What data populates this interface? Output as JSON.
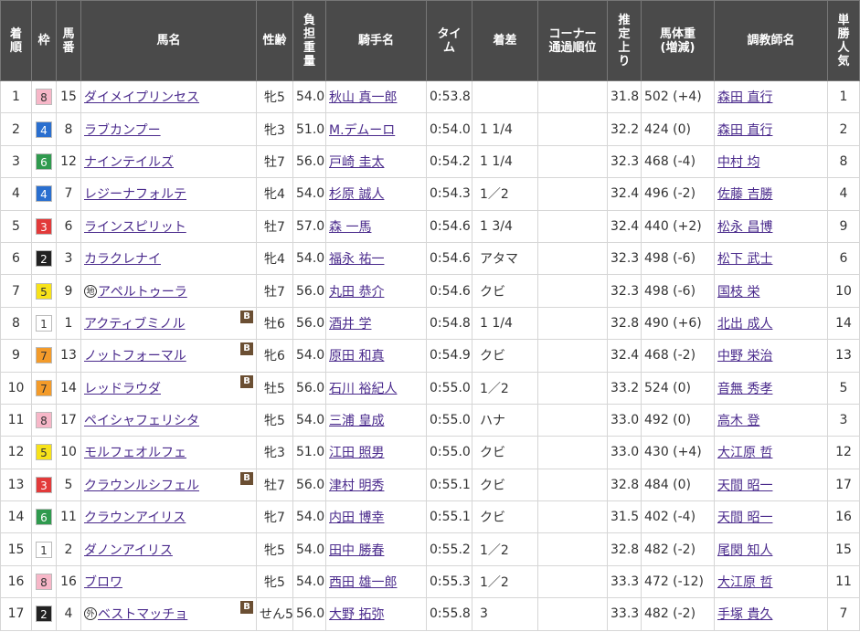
{
  "headers": {
    "rank": "着\n順",
    "waku": "枠",
    "umaban": "馬\n番",
    "horse": "馬名",
    "sexage": "性齢",
    "weight": "負\n担\n重\n量",
    "jockey": "騎手名",
    "time": "タイ\nム",
    "margin": "着差",
    "corner": "コーナー\n通過順位",
    "agari": "推\n定\n上\nり",
    "bodyweight": "馬体重\n(増減)",
    "trainer": "調教師名",
    "pop": "単\n勝\n人\n気"
  },
  "colors": {
    "header_bg": "#4a4a4a",
    "link": "#4a2a8c",
    "waku": {
      "1": {
        "bg": "#ffffff",
        "fg": "#333333"
      },
      "2": {
        "bg": "#222222",
        "fg": "#ffffff"
      },
      "3": {
        "bg": "#e23a3a",
        "fg": "#ffffff"
      },
      "4": {
        "bg": "#2a6fcf",
        "fg": "#ffffff"
      },
      "5": {
        "bg": "#f7e21a",
        "fg": "#333333"
      },
      "6": {
        "bg": "#2f9a4e",
        "fg": "#ffffff"
      },
      "7": {
        "bg": "#f39b2a",
        "fg": "#333333"
      },
      "8": {
        "bg": "#f7b7c8",
        "fg": "#333333"
      }
    }
  },
  "rows": [
    {
      "rank": "1",
      "waku": "8",
      "umaban": "15",
      "mark": "",
      "horse": "ダイメイプリンセス",
      "blinker": "",
      "sexage": "牝5",
      "weight": "54.0",
      "jockey": "秋山 真一郎",
      "time": "0:53.8",
      "margin": "",
      "corner": "",
      "agari": "31.8",
      "bodyweight": "502 (+4)",
      "trainer": "森田 直行",
      "pop": "1"
    },
    {
      "rank": "2",
      "waku": "4",
      "umaban": "8",
      "mark": "",
      "horse": "ラブカンプー",
      "blinker": "",
      "sexage": "牝3",
      "weight": "51.0",
      "jockey": "M.デムーロ",
      "time": "0:54.0",
      "margin": "1 1/4",
      "corner": "",
      "agari": "32.2",
      "bodyweight": "424 (0)",
      "trainer": "森田 直行",
      "pop": "2"
    },
    {
      "rank": "3",
      "waku": "6",
      "umaban": "12",
      "mark": "",
      "horse": "ナインテイルズ",
      "blinker": "",
      "sexage": "牡7",
      "weight": "56.0",
      "jockey": "戸崎 圭太",
      "time": "0:54.2",
      "margin": "1 1/4",
      "corner": "",
      "agari": "32.3",
      "bodyweight": "468 (-4)",
      "trainer": "中村 均",
      "pop": "8"
    },
    {
      "rank": "4",
      "waku": "4",
      "umaban": "7",
      "mark": "",
      "horse": "レジーナフォルテ",
      "blinker": "",
      "sexage": "牝4",
      "weight": "54.0",
      "jockey": "杉原 誠人",
      "time": "0:54.3",
      "margin": "1／2",
      "corner": "",
      "agari": "32.4",
      "bodyweight": "496 (-2)",
      "trainer": "佐藤 吉勝",
      "pop": "4"
    },
    {
      "rank": "5",
      "waku": "3",
      "umaban": "6",
      "mark": "",
      "horse": "ラインスピリット",
      "blinker": "",
      "sexage": "牡7",
      "weight": "57.0",
      "jockey": "森 一馬",
      "time": "0:54.6",
      "margin": "1 3/4",
      "corner": "",
      "agari": "32.4",
      "bodyweight": "440 (+2)",
      "trainer": "松永 昌博",
      "pop": "9"
    },
    {
      "rank": "6",
      "waku": "2",
      "umaban": "3",
      "mark": "",
      "horse": "カラクレナイ",
      "blinker": "",
      "sexage": "牝4",
      "weight": "54.0",
      "jockey": "福永 祐一",
      "time": "0:54.6",
      "margin": "アタマ",
      "corner": "",
      "agari": "32.3",
      "bodyweight": "498 (-6)",
      "trainer": "松下 武士",
      "pop": "6"
    },
    {
      "rank": "7",
      "waku": "5",
      "umaban": "9",
      "mark": "地",
      "horse": "アペルトゥーラ",
      "blinker": "",
      "sexage": "牡7",
      "weight": "56.0",
      "jockey": "丸田 恭介",
      "time": "0:54.6",
      "margin": "クビ",
      "corner": "",
      "agari": "32.3",
      "bodyweight": "498 (-6)",
      "trainer": "国枝 栄",
      "pop": "10"
    },
    {
      "rank": "8",
      "waku": "1",
      "umaban": "1",
      "mark": "",
      "horse": "アクティブミノル",
      "blinker": "B",
      "sexage": "牡6",
      "weight": "56.0",
      "jockey": "酒井 学",
      "time": "0:54.8",
      "margin": "1 1/4",
      "corner": "",
      "agari": "32.8",
      "bodyweight": "490 (+6)",
      "trainer": "北出 成人",
      "pop": "14"
    },
    {
      "rank": "9",
      "waku": "7",
      "umaban": "13",
      "mark": "",
      "horse": "ノットフォーマル",
      "blinker": "B",
      "sexage": "牝6",
      "weight": "54.0",
      "jockey": "原田 和真",
      "time": "0:54.9",
      "margin": "クビ",
      "corner": "",
      "agari": "32.4",
      "bodyweight": "468 (-2)",
      "trainer": "中野 栄治",
      "pop": "13"
    },
    {
      "rank": "10",
      "waku": "7",
      "umaban": "14",
      "mark": "",
      "horse": "レッドラウダ",
      "blinker": "B",
      "sexage": "牡5",
      "weight": "56.0",
      "jockey": "石川 裕紀人",
      "time": "0:55.0",
      "margin": "1／2",
      "corner": "",
      "agari": "33.2",
      "bodyweight": "524 (0)",
      "trainer": "音無 秀孝",
      "pop": "5"
    },
    {
      "rank": "11",
      "waku": "8",
      "umaban": "17",
      "mark": "",
      "horse": "ペイシャフェリシタ",
      "blinker": "",
      "sexage": "牝5",
      "weight": "54.0",
      "jockey": "三浦 皇成",
      "time": "0:55.0",
      "margin": "ハナ",
      "corner": "",
      "agari": "33.0",
      "bodyweight": "492 (0)",
      "trainer": "高木 登",
      "pop": "3"
    },
    {
      "rank": "12",
      "waku": "5",
      "umaban": "10",
      "mark": "",
      "horse": "モルフェオルフェ",
      "blinker": "",
      "sexage": "牝3",
      "weight": "51.0",
      "jockey": "江田 照男",
      "time": "0:55.0",
      "margin": "クビ",
      "corner": "",
      "agari": "33.0",
      "bodyweight": "430 (+4)",
      "trainer": "大江原 哲",
      "pop": "12"
    },
    {
      "rank": "13",
      "waku": "3",
      "umaban": "5",
      "mark": "",
      "horse": "クラウンルシフェル",
      "blinker": "B",
      "sexage": "牡7",
      "weight": "56.0",
      "jockey": "津村 明秀",
      "time": "0:55.1",
      "margin": "クビ",
      "corner": "",
      "agari": "32.8",
      "bodyweight": "484 (0)",
      "trainer": "天間 昭一",
      "pop": "17"
    },
    {
      "rank": "14",
      "waku": "6",
      "umaban": "11",
      "mark": "",
      "horse": "クラウンアイリス",
      "blinker": "",
      "sexage": "牝7",
      "weight": "54.0",
      "jockey": "内田 博幸",
      "time": "0:55.1",
      "margin": "クビ",
      "corner": "",
      "agari": "31.5",
      "bodyweight": "402 (-4)",
      "trainer": "天間 昭一",
      "pop": "16"
    },
    {
      "rank": "15",
      "waku": "1",
      "umaban": "2",
      "mark": "",
      "horse": "ダノンアイリス",
      "blinker": "",
      "sexage": "牝5",
      "weight": "54.0",
      "jockey": "田中 勝春",
      "time": "0:55.2",
      "margin": "1／2",
      "corner": "",
      "agari": "32.8",
      "bodyweight": "482 (-2)",
      "trainer": "尾関 知人",
      "pop": "15"
    },
    {
      "rank": "16",
      "waku": "8",
      "umaban": "16",
      "mark": "",
      "horse": "ブロワ",
      "blinker": "",
      "sexage": "牝5",
      "weight": "54.0",
      "jockey": "西田 雄一郎",
      "time": "0:55.3",
      "margin": "1／2",
      "corner": "",
      "agari": "33.3",
      "bodyweight": "472 (-12)",
      "trainer": "大江原 哲",
      "pop": "11"
    },
    {
      "rank": "17",
      "waku": "2",
      "umaban": "4",
      "mark": "外",
      "horse": "ベストマッチョ",
      "blinker": "B",
      "sexage": "せん5",
      "weight": "56.0",
      "jockey": "大野 拓弥",
      "time": "0:55.8",
      "margin": "3",
      "corner": "",
      "agari": "33.3",
      "bodyweight": "482 (-2)",
      "trainer": "手塚 貴久",
      "pop": "7"
    }
  ]
}
